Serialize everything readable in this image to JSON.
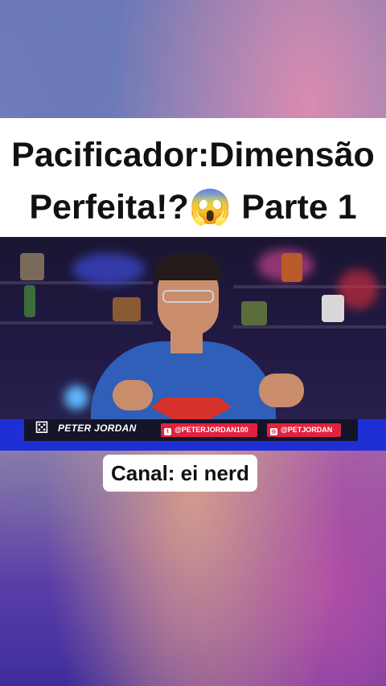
{
  "post": {
    "title_line1": "Pacificador:Dimensão",
    "title_line2": "Perfeita!?😱 Parte 1",
    "caption": "Canal: ei nerd"
  },
  "video": {
    "channel_name": "PETER JORDAN",
    "twitter_handle": "@PETERJORDAN100",
    "instagram_handle": "@PETJORDAN"
  },
  "colors": {
    "title_band": "#ffffff",
    "lower_third_blue": "#1f2fd6",
    "social_red": "#e0223f",
    "shirt_blue": "#2f5fb8"
  },
  "icons": {
    "brand": "dice-icon",
    "twitter": "twitter-icon",
    "instagram": "instagram-icon"
  }
}
